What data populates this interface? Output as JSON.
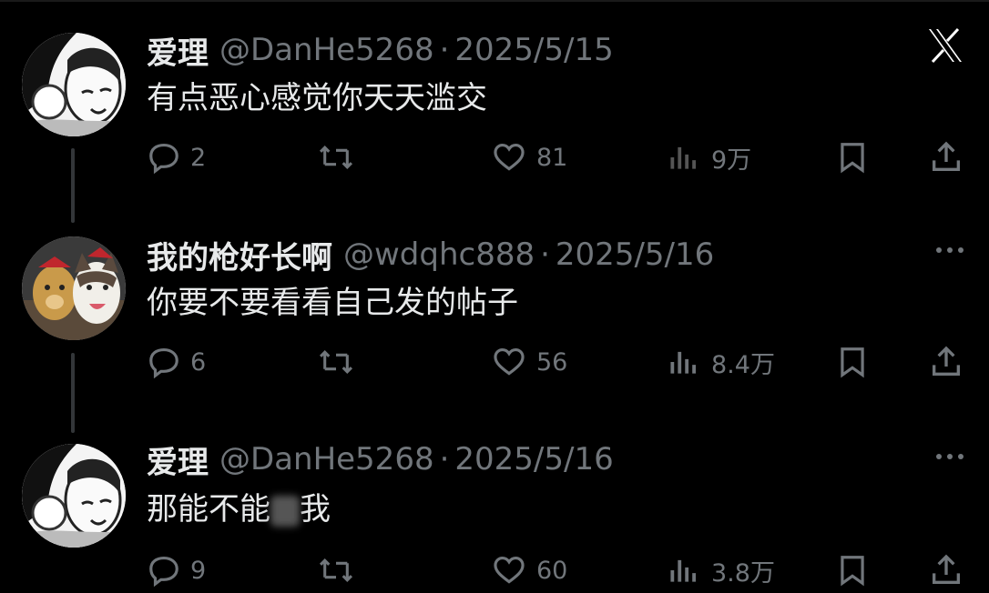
{
  "tweets": [
    {
      "name": "爱理",
      "handle": "@DanHe5268",
      "sep": "·",
      "date": "2025/5/15",
      "text": "有点恶心感觉你天天滥交",
      "replies": "2",
      "likes": "81",
      "views": "9万",
      "corner_icon": "x-logo-icon"
    },
    {
      "name": "我的枪好长啊",
      "handle": "@wdqhc888",
      "sep": "·",
      "date": "2025/5/16",
      "text": "你要不要看看自己发的帖子",
      "replies": "6",
      "likes": "56",
      "views": "8.4万",
      "corner_icon": "more-icon"
    },
    {
      "name": "爱理",
      "handle": "@DanHe5268",
      "sep": "·",
      "date": "2025/5/16",
      "text_before": "那能不能",
      "text_after": "我",
      "replies": "9",
      "likes": "60",
      "views": "3.8万",
      "corner_icon": "more-icon"
    }
  ],
  "colors": {
    "background": "#000000",
    "primary_text": "#e7e9ea",
    "secondary_text": "#71767b",
    "thread_line": "#333639"
  }
}
